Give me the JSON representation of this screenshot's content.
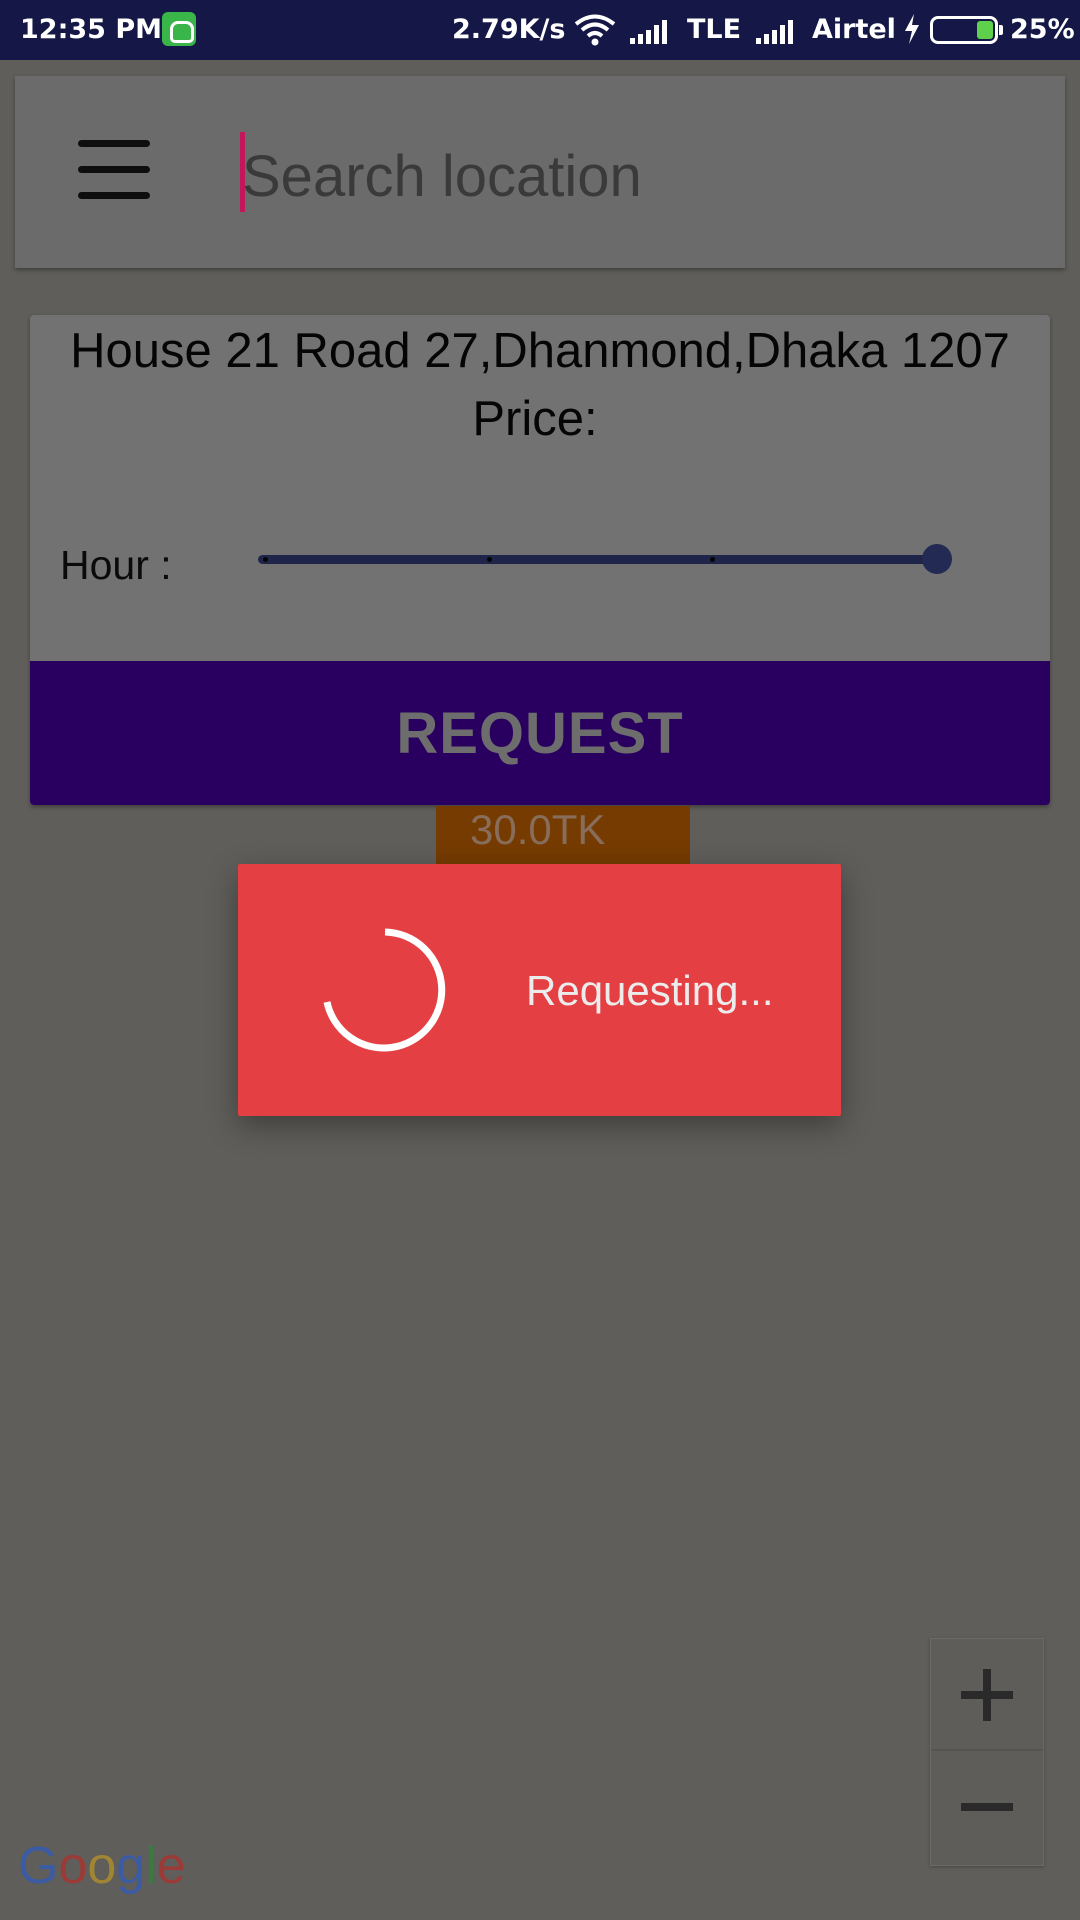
{
  "status_bar": {
    "time": "12:35 PM",
    "net_speed": "2.79K/s",
    "network_type": "TLE",
    "carrier": "Airtel",
    "battery_percent": "25%",
    "battery_level": 0.25
  },
  "search": {
    "placeholder": "Search location",
    "value": ""
  },
  "card": {
    "address": "House 21 Road 27,Dhanmond,Dhaka 1207",
    "price_label": "Price:",
    "hour_label": "Hour :",
    "hour_slider": {
      "min": 0,
      "max": 3,
      "value": 3,
      "tick_count": 4
    }
  },
  "request_button": {
    "label": "REQUEST"
  },
  "marker": {
    "price": "30.0TK"
  },
  "progress_dialog": {
    "text": "Requesting..."
  },
  "map": {
    "attribution_letters": [
      "G",
      "o",
      "o",
      "g",
      "l",
      "e"
    ],
    "zoom_in_icon": "plus-icon",
    "zoom_out_icon": "minus-icon"
  },
  "colors": {
    "status_bar": "#151846",
    "request_button": "#290060",
    "dialog": "#e43f42",
    "marker": "#753b00",
    "slider": "#1e2548"
  }
}
